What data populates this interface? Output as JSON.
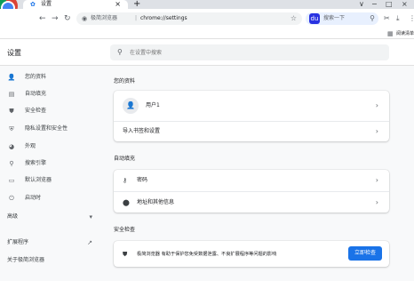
{
  "browser": {
    "tab_title": "设置",
    "tab_icon": "gear-icon",
    "new_tab": "+",
    "tab_close": "×",
    "window_controls": [
      "∨",
      "−",
      "□",
      "×"
    ],
    "omnibox_site": "极简浏览器",
    "omnibox_sep": "|",
    "omnibox_url": "chrome://settings",
    "search_engine_logo": "du",
    "search_placeholder": "搜索一下",
    "bookmarks_item": "阅读清单"
  },
  "settings": {
    "title": "设置",
    "search_placeholder": "在设置中搜索"
  },
  "sidebar": {
    "items": [
      {
        "icon": "person-icon",
        "glyph": "👤",
        "label": "您的资料"
      },
      {
        "icon": "autofill-icon",
        "glyph": "▤",
        "label": "自动填充"
      },
      {
        "icon": "shield-icon",
        "glyph": "⛊",
        "label": "安全检查"
      },
      {
        "icon": "privacy-shield-icon",
        "glyph": "⛨",
        "label": "隐私设置和安全性"
      },
      {
        "icon": "palette-icon",
        "glyph": "◕",
        "label": "外观"
      },
      {
        "icon": "search-icon",
        "glyph": "⚲",
        "label": "搜索引擎"
      },
      {
        "icon": "browser-icon",
        "glyph": "▭",
        "label": "默认浏览器"
      },
      {
        "icon": "power-icon",
        "glyph": "⏻",
        "label": "启动时"
      }
    ],
    "advanced": "高级",
    "advanced_glyph": "▾",
    "extensions": "扩展程序",
    "extensions_glyph": "↗",
    "about": "关于极简浏览器"
  },
  "main": {
    "profile": {
      "title": "您的资料",
      "user": "用户1",
      "import": "导入书签和设置"
    },
    "autofill": {
      "title": "自动填充",
      "passwords": "密码",
      "addresses": "地址和其他信息"
    },
    "safety": {
      "title": "安全检查",
      "text": "极简浏览器 有助于保护您免受数据泄露、不良扩展程序等问题的影响",
      "button": "立即检查"
    }
  },
  "colors": {
    "accent": "#1a73e8",
    "background": "#f8f9fa",
    "card": "#ffffff"
  }
}
